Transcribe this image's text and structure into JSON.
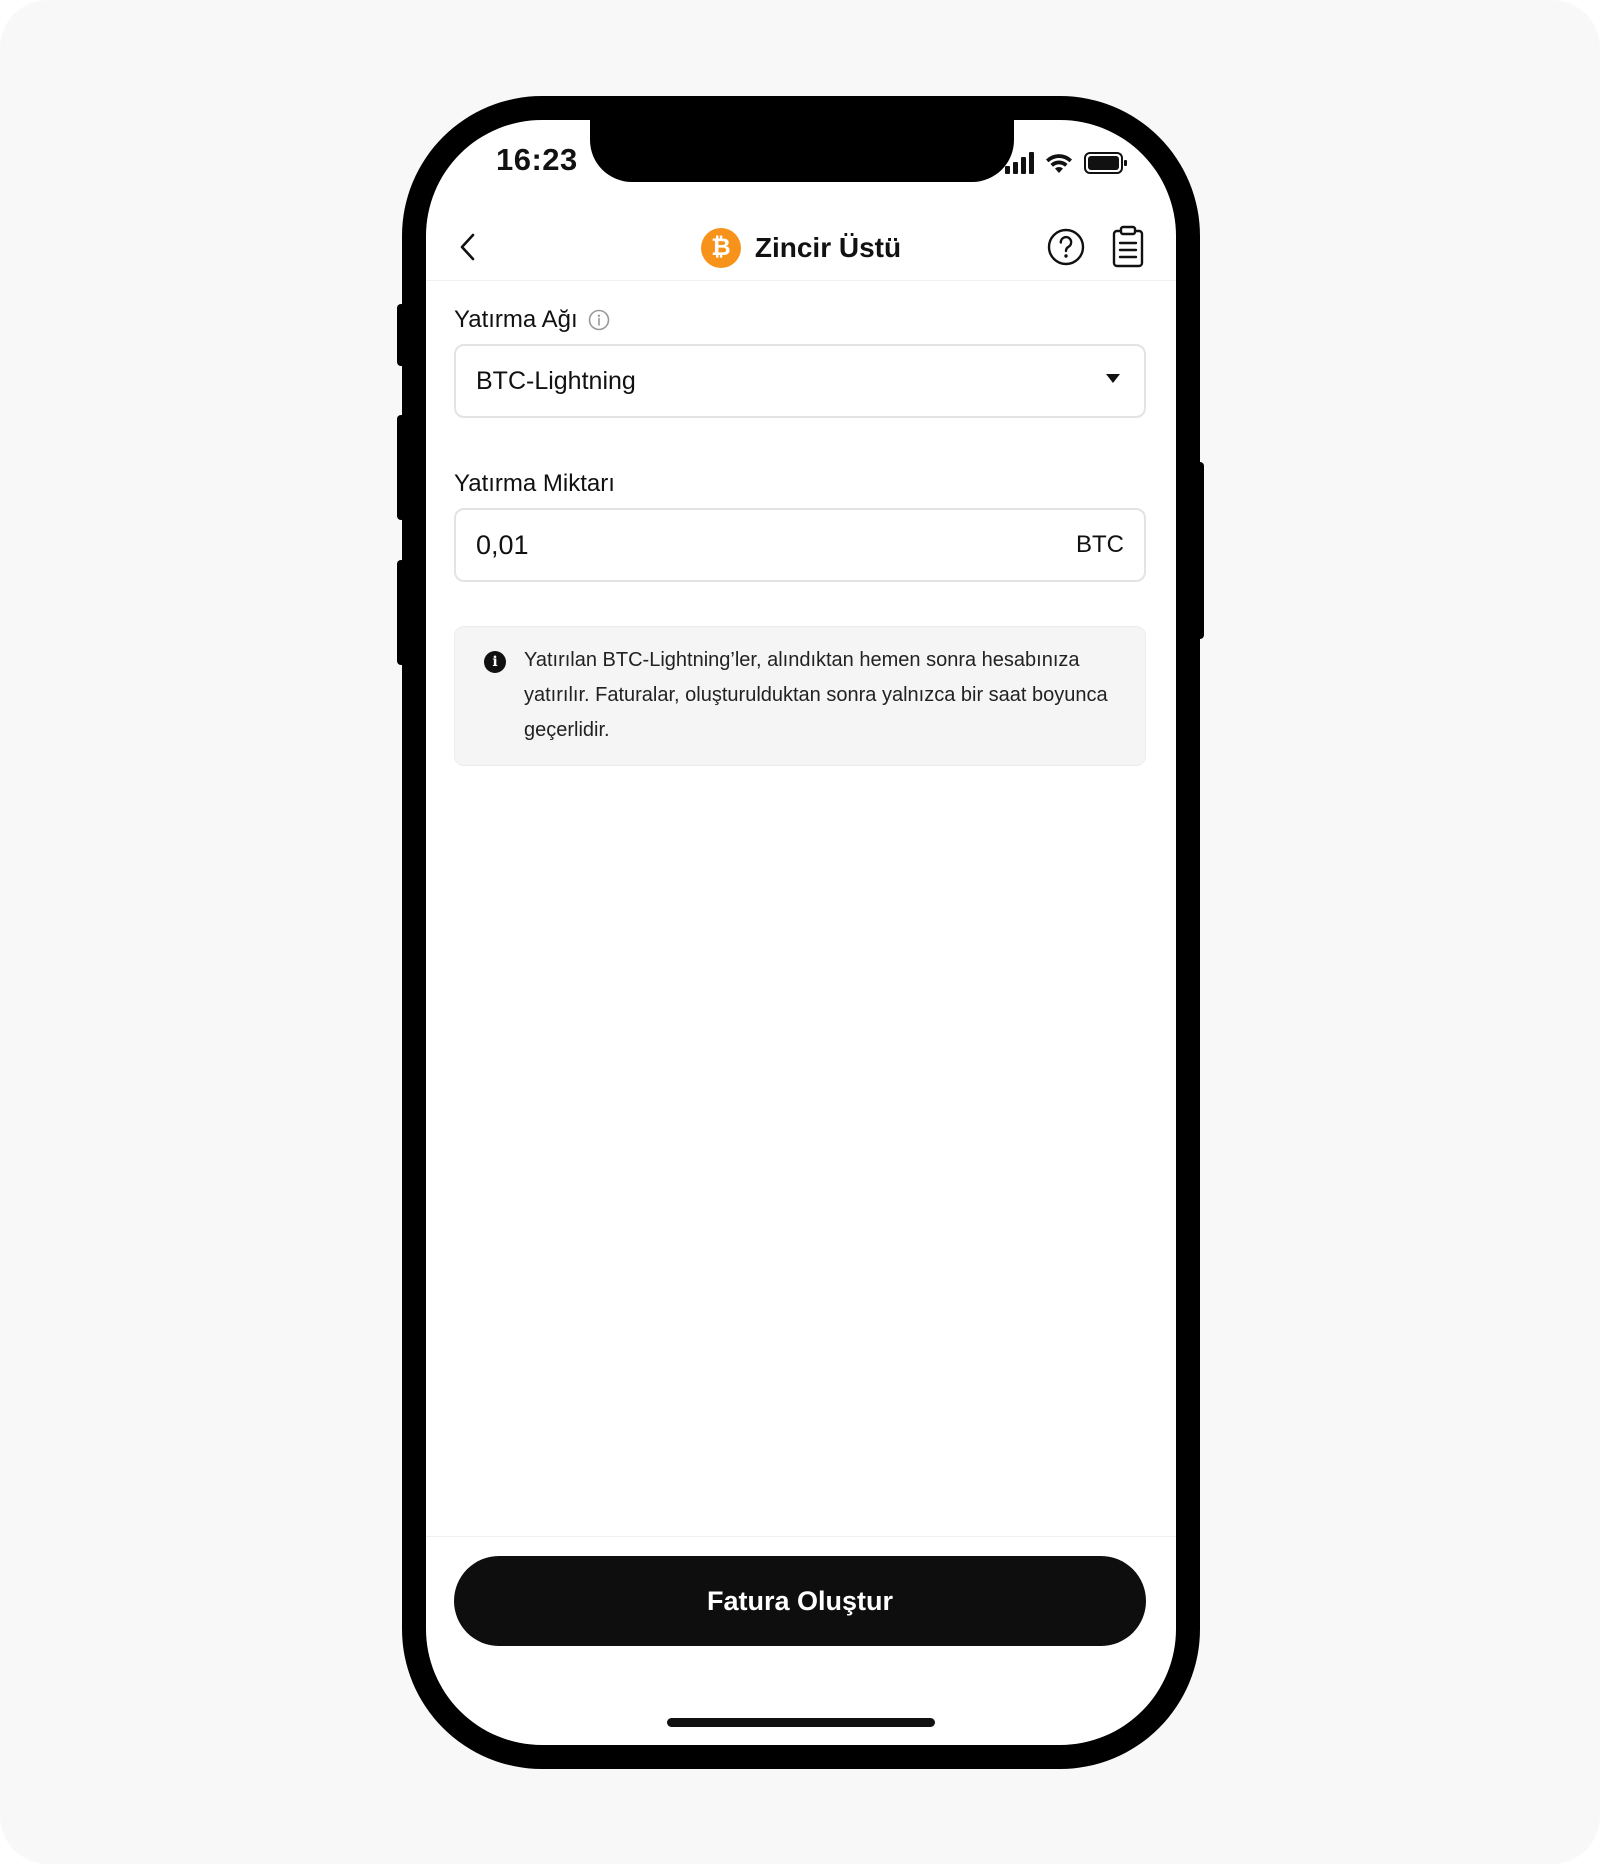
{
  "status_bar": {
    "time": "16:23"
  },
  "nav": {
    "title": "Zincir Üstü",
    "coin_symbol": "₿",
    "back_icon": "chevron-left-icon",
    "help_icon": "question-circle-icon",
    "history_icon": "clipboard-list-icon"
  },
  "network": {
    "label": "Yatırma Ağı",
    "selected": "BTC-Lightning"
  },
  "amount": {
    "label": "Yatırma Miktarı",
    "value": "0,01",
    "unit": "BTC"
  },
  "notice": {
    "text": "Yatırılan BTC-Lightning’ler, alındıktan hemen sonra hesabınıza yatırılır. Faturalar, oluşturulduktan sonra yalnızca bir saat boyunca geçerlidir."
  },
  "actions": {
    "create_invoice": "Fatura Oluştur"
  },
  "colors": {
    "accent_btc": "#f7931a",
    "primary_button": "#0e0e0e",
    "notice_bg": "#f5f5f5"
  }
}
